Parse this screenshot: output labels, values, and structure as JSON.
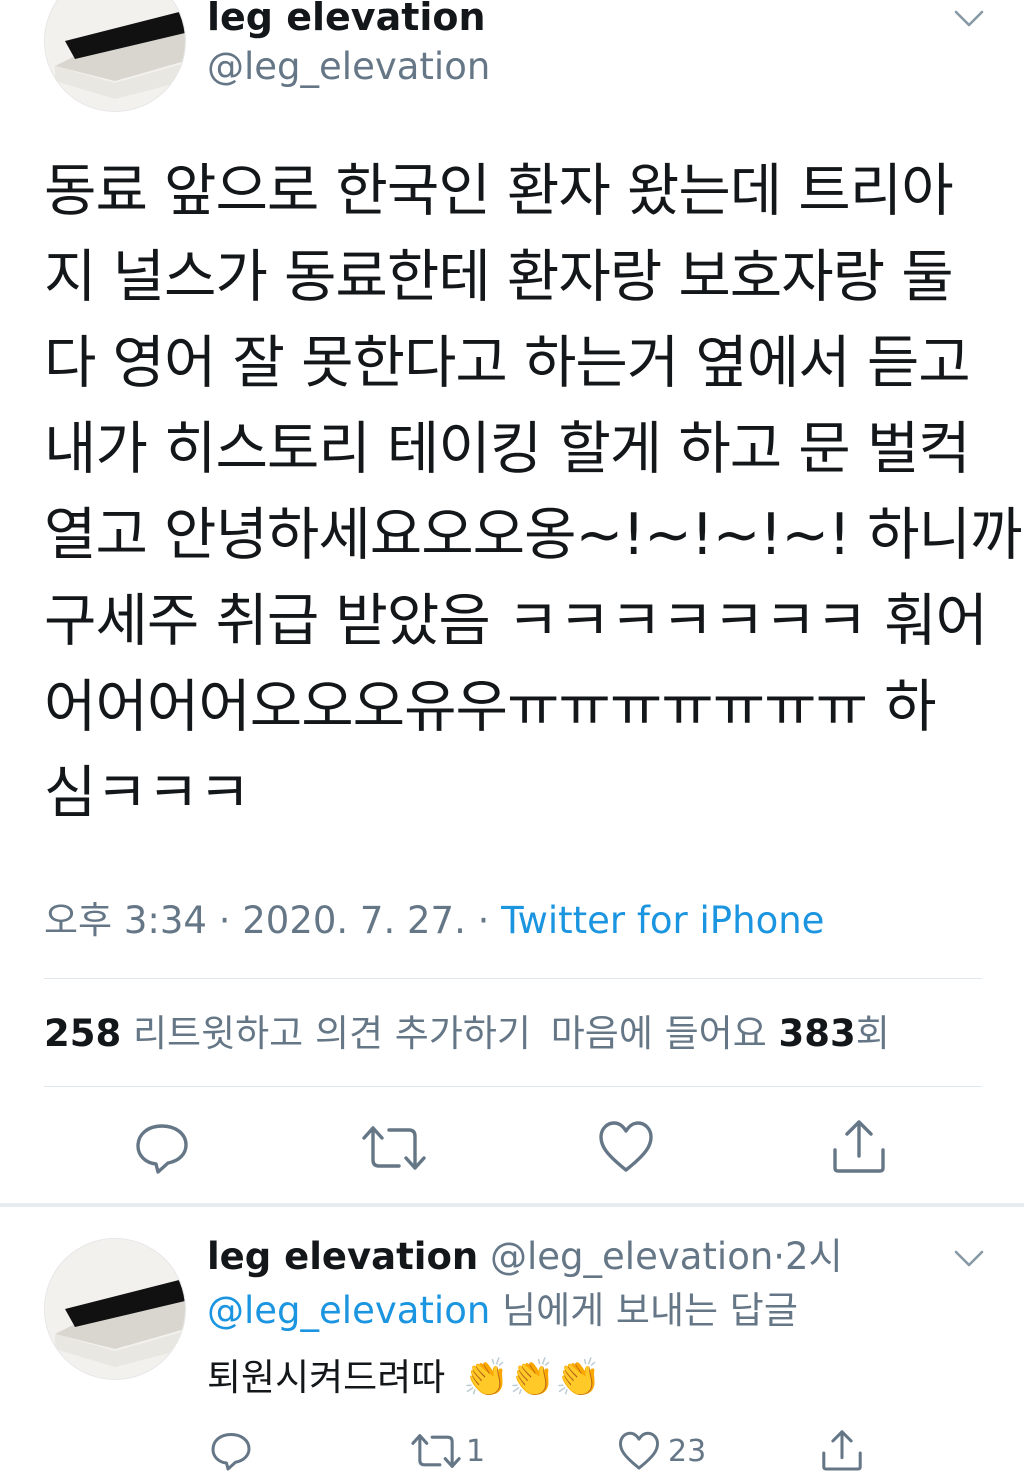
{
  "tweet": {
    "display_name": "leg elevation",
    "handle": "@leg_elevation",
    "avatar_caption": "Memory Foam Top - For Extra Comfort",
    "body_lines": [
      "동료 앞으로 한국인 환자 왔는데 트리아",
      "지 널스가 동료한테 환자랑 보호자랑 둘",
      "다 영어 잘 못한다고 하는거 옆에서 듣고",
      "내가 히스토리 테이킹 할게 하고 문 벌컥",
      "열고 안녕하세요오오옹~!~!~!~! 하니까",
      "구세주 취급 받았음 ㅋㅋㅋㅋㅋㅋㅋ 훠어",
      "어어어어오오오유우ㅠㅠㅠㅠㅠㅠㅠ 하",
      "심ㅋㅋㅋ"
    ],
    "time": "오후 3:34",
    "date": "2020. 7. 27.",
    "separator": "·",
    "source": "Twitter for iPhone",
    "retweet_count": "258",
    "retweet_label": "리트윗하고 의견 추가하기",
    "likes_label": "마음에 들어요",
    "likes_count": "383",
    "likes_suffix": "회",
    "actions": {
      "reply_icon": "reply-icon",
      "retweet_icon": "retweet-icon",
      "like_icon": "heart-icon",
      "share_icon": "share-icon"
    }
  },
  "reply": {
    "display_name": "leg elevation",
    "handle": "@leg_elevation",
    "dot": "·",
    "time": "2시",
    "replying_to_handle": "@leg_elevation",
    "replying_to_suffix": "님에게 보내는 답글",
    "text": "퇴원시켜드려따",
    "emoji": "👏👏👏",
    "retweet_count": "1",
    "like_count": "23"
  },
  "colors": {
    "link": "#1b95e0",
    "secondary": "#657786",
    "icon": "#657786",
    "divider": "#e1e8ed"
  }
}
